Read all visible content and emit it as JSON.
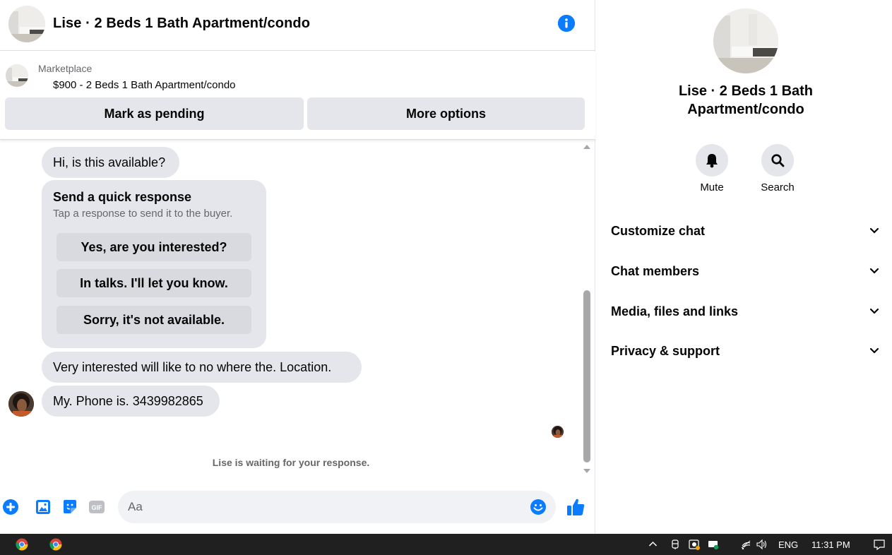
{
  "header": {
    "title": "Lise · 2 Beds 1 Bath Apartment/condo",
    "accent_color": "#0a7cff"
  },
  "listing": {
    "source": "Marketplace",
    "summary": "$900 - 2 Beds 1 Bath Apartment/condo",
    "mark_pending_label": "Mark as pending",
    "more_options_label": "More options"
  },
  "messages": {
    "first": "Hi, is this available?",
    "quick_response": {
      "title": "Send a quick response",
      "subtitle": "Tap a response to send it to the buyer.",
      "options": [
        "Yes, are you interested?",
        "In talks. I'll let you know.",
        "Sorry, it's not available."
      ]
    },
    "second": "Very interested will like to no where the. Location.",
    "third": "My. Phone is. 3439982865",
    "waiting": "Lise is waiting for your response."
  },
  "composer": {
    "placeholder": "Aa",
    "icons": [
      "plus-icon",
      "image-icon",
      "sticker-icon",
      "gif-icon",
      "emoji-icon",
      "like-icon"
    ],
    "gif_label": "GIF"
  },
  "info_panel": {
    "name": "Lise · 2 Beds 1 Bath Apartment/condo",
    "mute_label": "Mute",
    "search_label": "Search",
    "sections": [
      "Customize chat",
      "Chat members",
      "Media, files and links",
      "Privacy & support"
    ]
  },
  "taskbar": {
    "language": "ENG",
    "time": "11:31 PM"
  }
}
